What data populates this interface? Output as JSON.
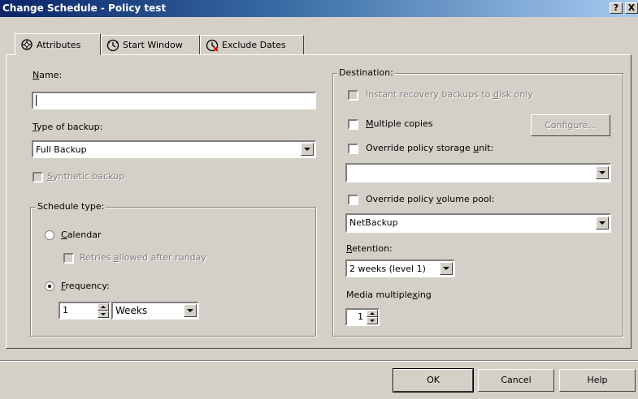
{
  "window": {
    "title": "Change Schedule - Policy test",
    "help_btn": "?",
    "close_btn": "X"
  },
  "tabs": [
    {
      "label": "Attributes",
      "icon": "attributes-icon",
      "selected": true
    },
    {
      "label": "Start Window",
      "icon": "clock-icon",
      "selected": false
    },
    {
      "label": "Exclude Dates",
      "icon": "exclude-dates-icon",
      "selected": false
    }
  ],
  "left": {
    "name_label_u": "N",
    "name_label_rest": "ame:",
    "name_value": "",
    "type_label_u": "T",
    "type_label_rest": "ype of backup:",
    "type_value": "Full Backup",
    "synthetic_u": "S",
    "synthetic_rest": "ynthetic backup",
    "schedule_group": "Schedule type:",
    "calendar_u": "C",
    "calendar_rest": "alendar",
    "retries_pre": "Retries ",
    "retries_u": "a",
    "retries_post": "llowed after runday",
    "frequency_u": "F",
    "frequency_rest": "requency:",
    "frequency_value": "1",
    "frequency_unit": "Weeks"
  },
  "right": {
    "destination_group": "Destination:",
    "instant_pre": "Instant recovery backups to ",
    "instant_u": "d",
    "instant_post": "isk only",
    "multiple_u": "M",
    "multiple_rest": "ultiple copies",
    "configure_label": "Configure...",
    "override_unit_pre": "Override policy storage ",
    "override_unit_u": "u",
    "override_unit_post": "nit:",
    "storage_unit_value": "",
    "override_pool_pre": "Override policy ",
    "override_pool_u": "v",
    "override_pool_post": "olume pool:",
    "pool_value": "NetBackup",
    "retention_u": "R",
    "retention_rest": "etention:",
    "retention_value": "2 weeks (level 1)",
    "multiplexing_pre": "Media multiple",
    "multiplexing_u": "x",
    "multiplexing_post": "ing",
    "multiplexing_value": "1"
  },
  "buttons": {
    "ok": "OK",
    "cancel": "Cancel",
    "help": "Help"
  },
  "colors": {
    "title_start": "#0a246a",
    "title_end": "#a6caf0",
    "face": "#d4d0c8"
  }
}
